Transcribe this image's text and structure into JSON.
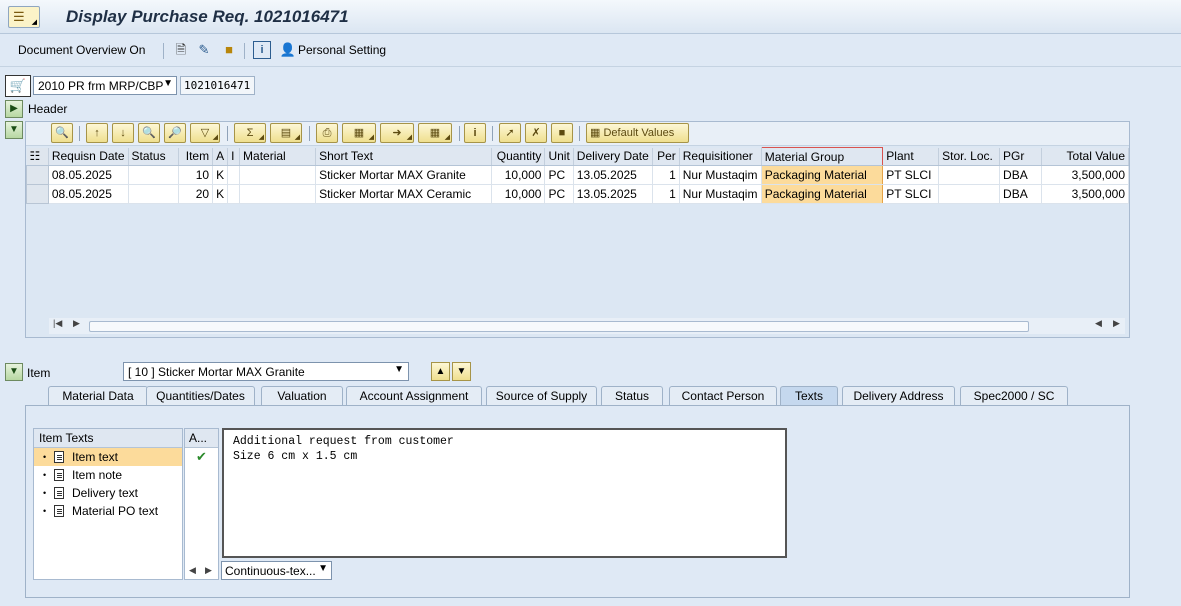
{
  "window": {
    "title": "Display Purchase Req. 1021016471"
  },
  "app_toolbar": {
    "doc_overview_label": "Document Overview On",
    "personal_setting_label": "Personal Setting"
  },
  "header_area": {
    "doc_type_value": "2010 PR frm MRP/CBP",
    "doc_number": "1021016471",
    "header_label": "Header"
  },
  "grid_toolbar": {
    "default_values_label": "Default Values"
  },
  "items_table": {
    "columns": [
      "Requisn Date",
      "Status",
      "Item",
      "A",
      "I",
      "Material",
      "Short Text",
      "Quantity",
      "Unit",
      "Delivery Date",
      "Per",
      "Requisitioner",
      "Material Group",
      "Plant",
      "Stor. Loc.",
      "PGr",
      "Total Value"
    ],
    "rows": [
      [
        "08.05.2025",
        "",
        "10",
        "K",
        "",
        "",
        "Sticker Mortar MAX Granite",
        "10,000",
        "PC",
        "13.05.2025",
        "1",
        "Nur Mustaqim",
        "Packaging Material",
        "PT SLCI",
        "",
        "DBA",
        "3,500,000"
      ],
      [
        "08.05.2025",
        "",
        "20",
        "K",
        "",
        "",
        "Sticker Mortar MAX Ceramic",
        "10,000",
        "PC",
        "13.05.2025",
        "1",
        "Nur Mustaqim",
        "Packaging Material",
        "PT SLCI",
        "",
        "DBA",
        "3,500,000"
      ]
    ]
  },
  "item_section": {
    "label": "Item",
    "selected_item": "[ 10 ] Sticker Mortar MAX Granite"
  },
  "tabs": [
    {
      "label": "Material Data"
    },
    {
      "label": "Quantities/Dates"
    },
    {
      "label": "Valuation"
    },
    {
      "label": "Account Assignment"
    },
    {
      "label": "Source of Supply"
    },
    {
      "label": "Status"
    },
    {
      "label": "Contact Person"
    },
    {
      "label": "Texts"
    },
    {
      "label": "Delivery Address"
    },
    {
      "label": "Spec2000 / SC"
    }
  ],
  "texts_tab": {
    "tree_header": "Item Texts",
    "status_header": "A...",
    "items": [
      {
        "label": "Item text"
      },
      {
        "label": "Item note"
      },
      {
        "label": "Delivery text"
      },
      {
        "label": "Material PO text"
      }
    ],
    "editor_line1": "Additional request from customer",
    "editor_line2": "Size 6 cm x 1.5 cm",
    "format_value": "Continuous-tex..."
  }
}
